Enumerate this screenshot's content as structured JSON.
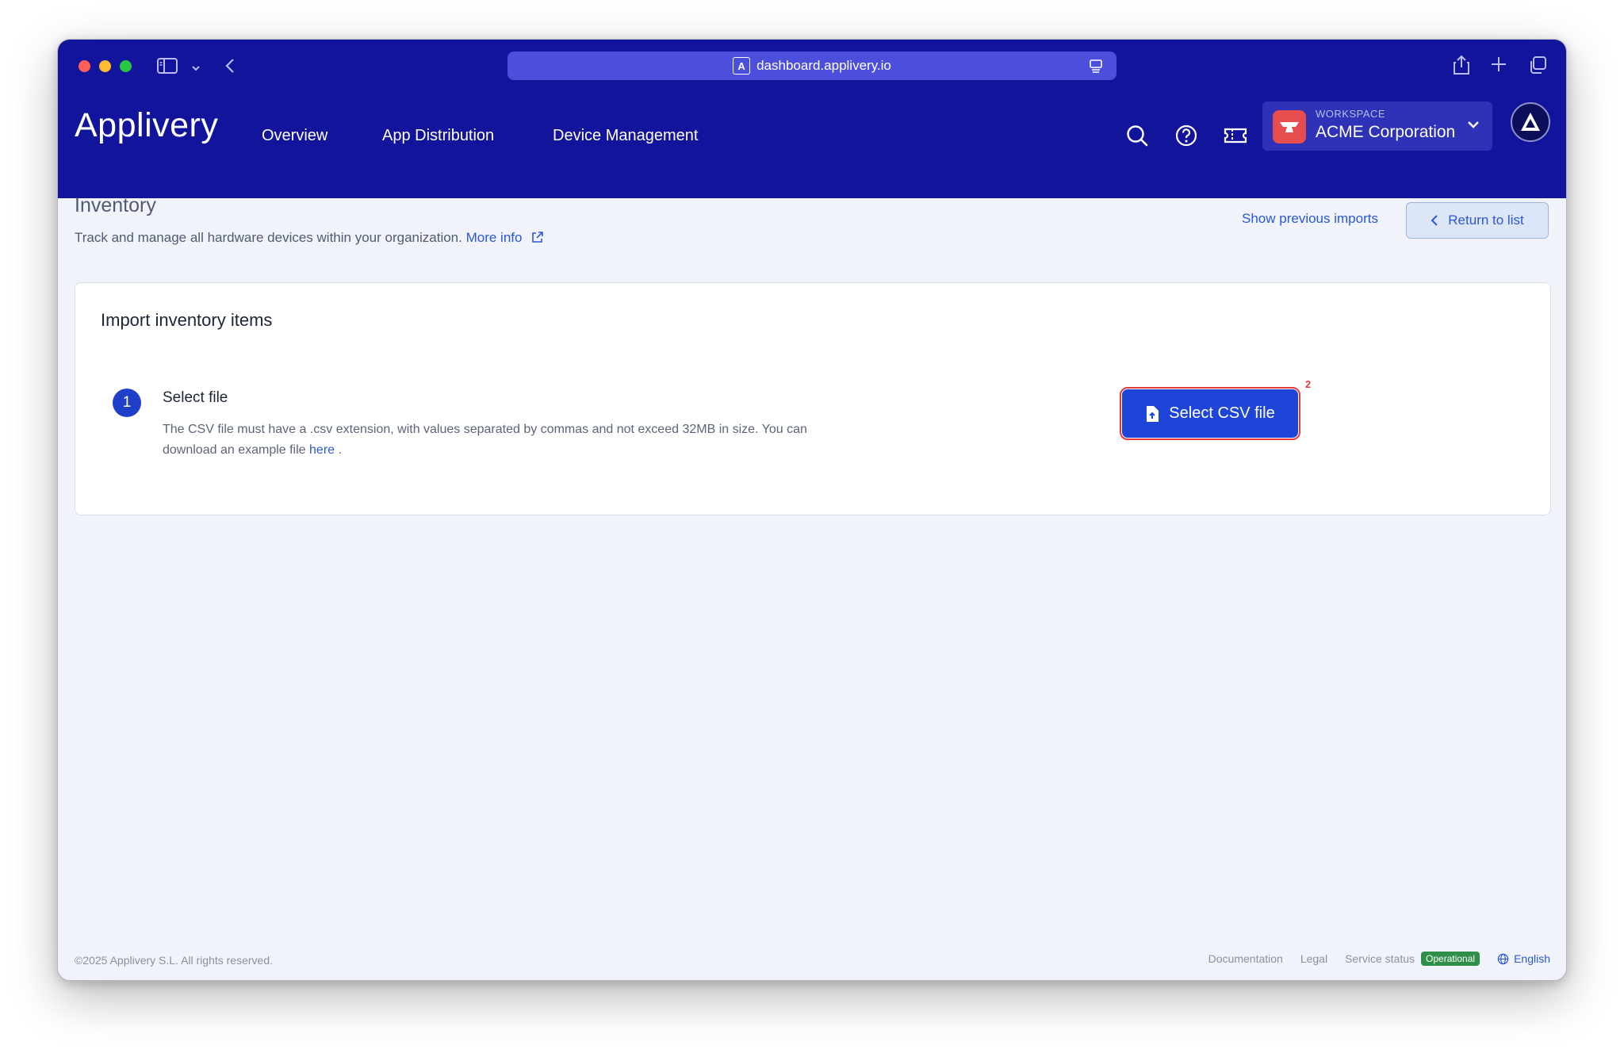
{
  "browser": {
    "url": "dashboard.applivery.io"
  },
  "nav": {
    "brand": "Applivery",
    "links": [
      "Overview",
      "App Distribution",
      "Device Management"
    ]
  },
  "workspace": {
    "label": "WORKSPACE",
    "name": "ACME Corporation"
  },
  "page": {
    "title": "Inventory",
    "description": "Track and manage all hardware devices within your organization.",
    "more_info": "More info",
    "show_previous": "Show previous imports",
    "return_label": "Return to list"
  },
  "card": {
    "title": "Import inventory items",
    "step_number": "1",
    "step_title": "Select file",
    "step_desc": "The CSV file must have a .csv extension, with values separated by commas and not exceed 32MB in size. You can download an example file ",
    "here_link": "here",
    "step_desc_end": " .",
    "select_button": "Select CSV file",
    "badge": "2"
  },
  "footer": {
    "copyright": "©2025 Applivery S.L. All rights reserved.",
    "documentation": "Documentation",
    "legal": "Legal",
    "service_status": "Service status",
    "status": "Operational",
    "language": "English"
  },
  "colors": {
    "nav_bg": "#13149c",
    "accent": "#2b57d6",
    "primary_button": "#1f45d8",
    "status_green": "#2f8f4a",
    "highlight_red": "#e43c3c"
  }
}
